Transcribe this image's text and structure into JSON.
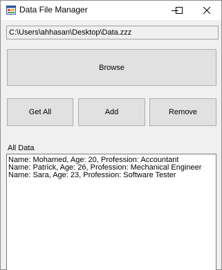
{
  "window": {
    "title": "Data File Manager",
    "icon": "app-window-icon"
  },
  "caption_buttons": [
    "minimize-icon",
    "maximize-icon",
    "close-icon"
  ],
  "file_path": "C:\\Users\\ahhasan\\Desktop\\Data.zzz",
  "buttons": {
    "browse": "Browse",
    "get_all": "Get All",
    "add": "Add",
    "remove": "Remove"
  },
  "list": {
    "label": "All Data",
    "items": [
      "Name: Mohamed, Age: 20, Profession: Accountant",
      "Name: Patrick, Age: 26, Profession: Mechanical Engineer",
      "Name: Sara, Age: 23, Profession: Software Tester"
    ]
  }
}
